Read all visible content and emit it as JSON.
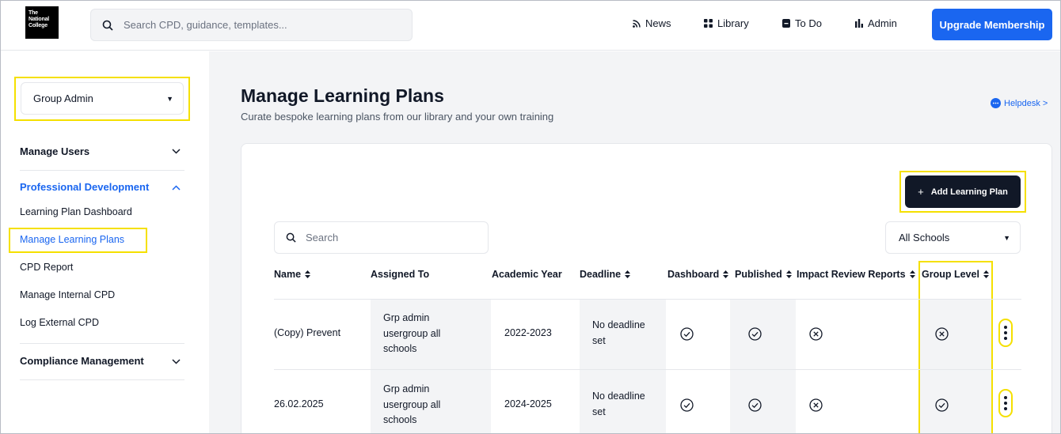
{
  "logo": {
    "lines": [
      "The",
      "National",
      "College"
    ]
  },
  "search": {
    "placeholder": "Search CPD, guidance, templates..."
  },
  "nav": {
    "news": "News",
    "library": "Library",
    "todo": "To Do",
    "admin": "Admin"
  },
  "upgrade_label": "Upgrade Membership",
  "sidebar": {
    "group_select": "Group Admin",
    "manage_users": "Manage Users",
    "professional_development": "Professional Development",
    "items": [
      "Learning Plan Dashboard",
      "Manage Learning Plans",
      "CPD Report",
      "Manage Internal CPD",
      "Log External CPD"
    ],
    "compliance": "Compliance Management"
  },
  "main": {
    "title": "Manage Learning Plans",
    "subtitle": "Curate bespoke learning plans from our library and your own training",
    "helpdesk": "Helpdesk >",
    "add_button": "Add Learning Plan",
    "table_search_placeholder": "Search",
    "schools_filter": "All Schools"
  },
  "table": {
    "headers": {
      "name": "Name",
      "assigned": "Assigned To",
      "year": "Academic Year",
      "deadline": "Deadline",
      "dashboard": "Dashboard",
      "published": "Published",
      "impact": "Impact Review Reports",
      "group": "Group Level"
    },
    "rows": [
      {
        "name": "(Copy) Prevent",
        "assigned": [
          "Grp admin",
          "usergroup all",
          "schools"
        ],
        "year": "2022-2023",
        "deadline": [
          "No deadline",
          "set"
        ],
        "dashboard": "check",
        "published": "check",
        "impact": "cross",
        "group": "cross"
      },
      {
        "name": "26.02.2025",
        "assigned": [
          "Grp admin",
          "usergroup all",
          "schools"
        ],
        "year": "2024-2025",
        "deadline": [
          "No deadline",
          "set"
        ],
        "dashboard": "check",
        "published": "check",
        "impact": "cross",
        "group": "check"
      }
    ]
  },
  "colors": {
    "accent": "#1a66f0",
    "highlight": "#f5e000",
    "dark_button": "#111827"
  }
}
